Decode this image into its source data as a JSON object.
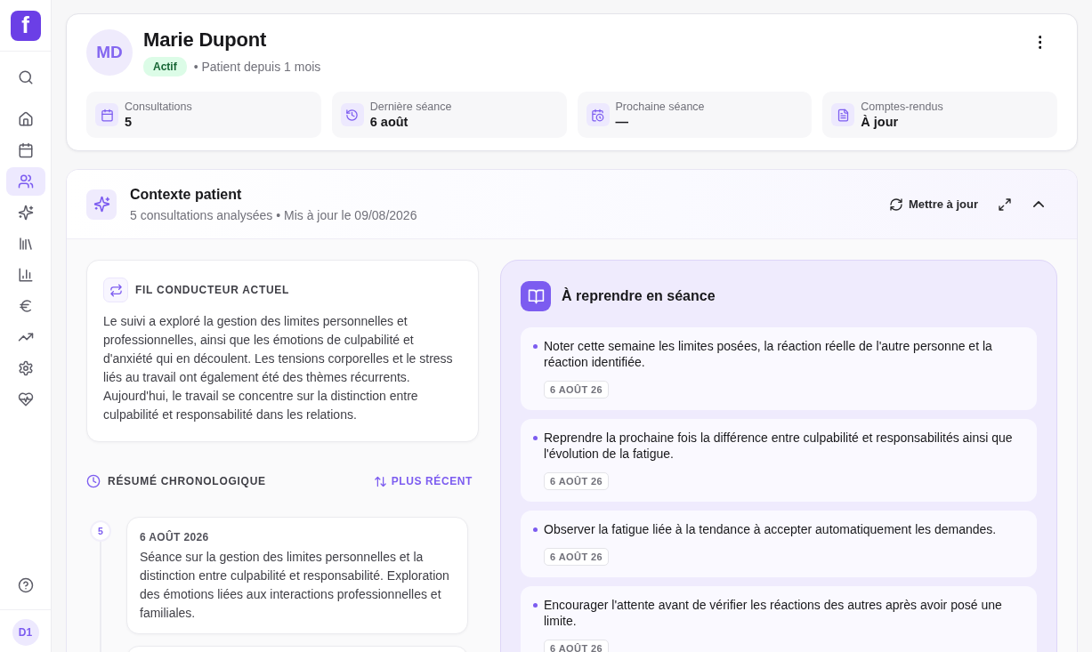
{
  "sidebar": {
    "logo": "f",
    "top_items": [
      {
        "kind": "search",
        "selected": false
      }
    ],
    "items": [
      {
        "kind": "home",
        "selected": false
      },
      {
        "kind": "calendar",
        "selected": false
      },
      {
        "kind": "users",
        "selected": true
      },
      {
        "kind": "sparkles",
        "selected": false
      },
      {
        "kind": "library",
        "selected": false
      },
      {
        "kind": "chart",
        "selected": false
      },
      {
        "kind": "euro",
        "selected": false
      },
      {
        "kind": "trending",
        "selected": false
      },
      {
        "kind": "settings",
        "selected": false
      },
      {
        "kind": "heart-pulse",
        "selected": false
      }
    ],
    "bottom_items": [
      {
        "kind": "help",
        "selected": false
      }
    ],
    "user": {
      "initials": "D1"
    }
  },
  "patient": {
    "initials": "MD",
    "name": "Marie Dupont",
    "status": "Actif",
    "since": "• Patient depuis 1 mois"
  },
  "stats": [
    {
      "kind": "calendar",
      "label": "Consultations",
      "value": "5"
    },
    {
      "kind": "history",
      "label": "Dernière séance",
      "value": "6 août"
    },
    {
      "kind": "calendar-clock",
      "label": "Prochaine séance",
      "value": "—"
    },
    {
      "kind": "file-text",
      "label": "Comptes-rendus",
      "value": "À jour"
    }
  ],
  "context": {
    "title": "Contexte patient",
    "subtitle": "5 consultations analysées • Mis à jour le 09/08/2026",
    "update_button": "Mettre à jour",
    "thread": {
      "heading": "FIL CONDUCTEUR ACTUEL",
      "text": "Le suivi a exploré la gestion des limites personnelles et professionnelles, ainsi que les émotions de culpabilité et d'anxiété qui en découlent. Les tensions corporelles et le stress liés au travail ont également été des thèmes récurrents. Aujourd'hui, le travail se concentre sur la distinction entre culpabilité et responsabilité dans les relations."
    },
    "timeline": {
      "heading": "RÉSUMÉ CHRONOLOGIQUE",
      "sort_button": "PLUS RÉCENT",
      "entries": [
        {
          "number": "5",
          "date": "6 AOÛT 2026",
          "text": "Séance sur la gestion des limites personnelles et la distinction entre culpabilité et responsabilité. Exploration des émotions liées aux interactions professionnelles et familiales."
        }
      ]
    },
    "followups": {
      "title": "À reprendre en séance",
      "items": [
        {
          "text": "Noter cette semaine les limites posées, la réaction réelle de l'autre personne et la réaction identifiée.",
          "date": "6 AOÛT 26"
        },
        {
          "text": "Reprendre la prochaine fois la différence entre culpabilité et responsabilités ainsi que l'évolution de la fatigue.",
          "date": "6 AOÛT 26"
        },
        {
          "text": "Observer la fatigue liée à la tendance à accepter automatiquement les demandes.",
          "date": "6 AOÛT 26"
        },
        {
          "text": "Encourager l'attente avant de vérifier les réactions des autres après avoir posé une limite.",
          "date": "6 AOÛT 26"
        }
      ]
    }
  }
}
